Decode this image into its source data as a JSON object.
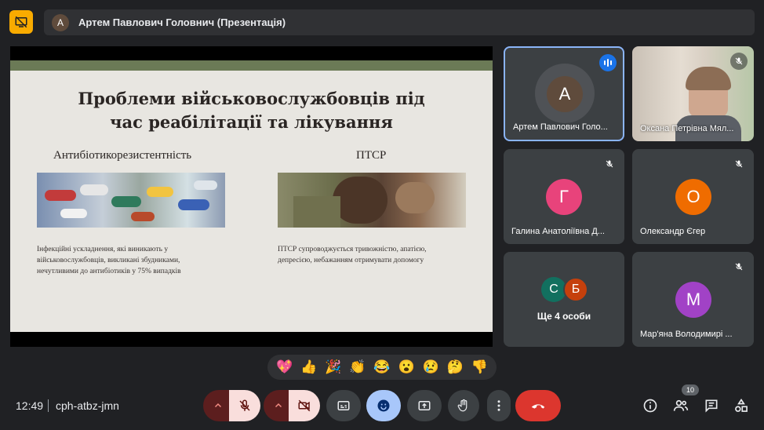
{
  "header": {
    "presenter_initial": "А",
    "presenter_title": "Артем Павлович Головнич (Презентація)"
  },
  "slide": {
    "title_line1": "Проблеми військовослужбовців під",
    "title_line2": "час реабілітації та лікування",
    "left": {
      "heading": "Антибіотикорезистентність",
      "text_line1": "Інфекційні ускладнення, які виникають у",
      "text_line2": "військовослужбовців, викликані збудниками,",
      "text_line3": "нечутливими до антибіотиків у 75% випадків"
    },
    "right": {
      "heading": "ПТСР",
      "text_line1": "ПТСР супроводжується тривожністю, апатією,",
      "text_line2": "депресією, небажанням отримувати допомогу"
    }
  },
  "participants": [
    {
      "initial": "А",
      "name": "Артем Павлович Голо...",
      "color": "#5f4b3c"
    },
    {
      "name": "Оксана Петрівна Мял..."
    },
    {
      "initial": "Г",
      "name": "Галина Анатоліївна Д...",
      "color": "#e8437b"
    },
    {
      "initial": "О",
      "name": "Олександр Єгер",
      "color": "#ef6c00"
    },
    {
      "initial_a": "С",
      "initial_b": "Б",
      "color_a": "#12705f",
      "color_b": "#c5400c",
      "label": "Ще 4 особи"
    },
    {
      "initial": "М",
      "name": "Мар'яна Володимирі ...",
      "color": "#a142c6"
    }
  ],
  "reactions": [
    "💖",
    "👍",
    "🎉",
    "👏",
    "😂",
    "😮",
    "😢",
    "🤔",
    "👎"
  ],
  "footer": {
    "time": "12:49",
    "meeting_code": "cph-atbz-jmn",
    "people_count": "10"
  }
}
